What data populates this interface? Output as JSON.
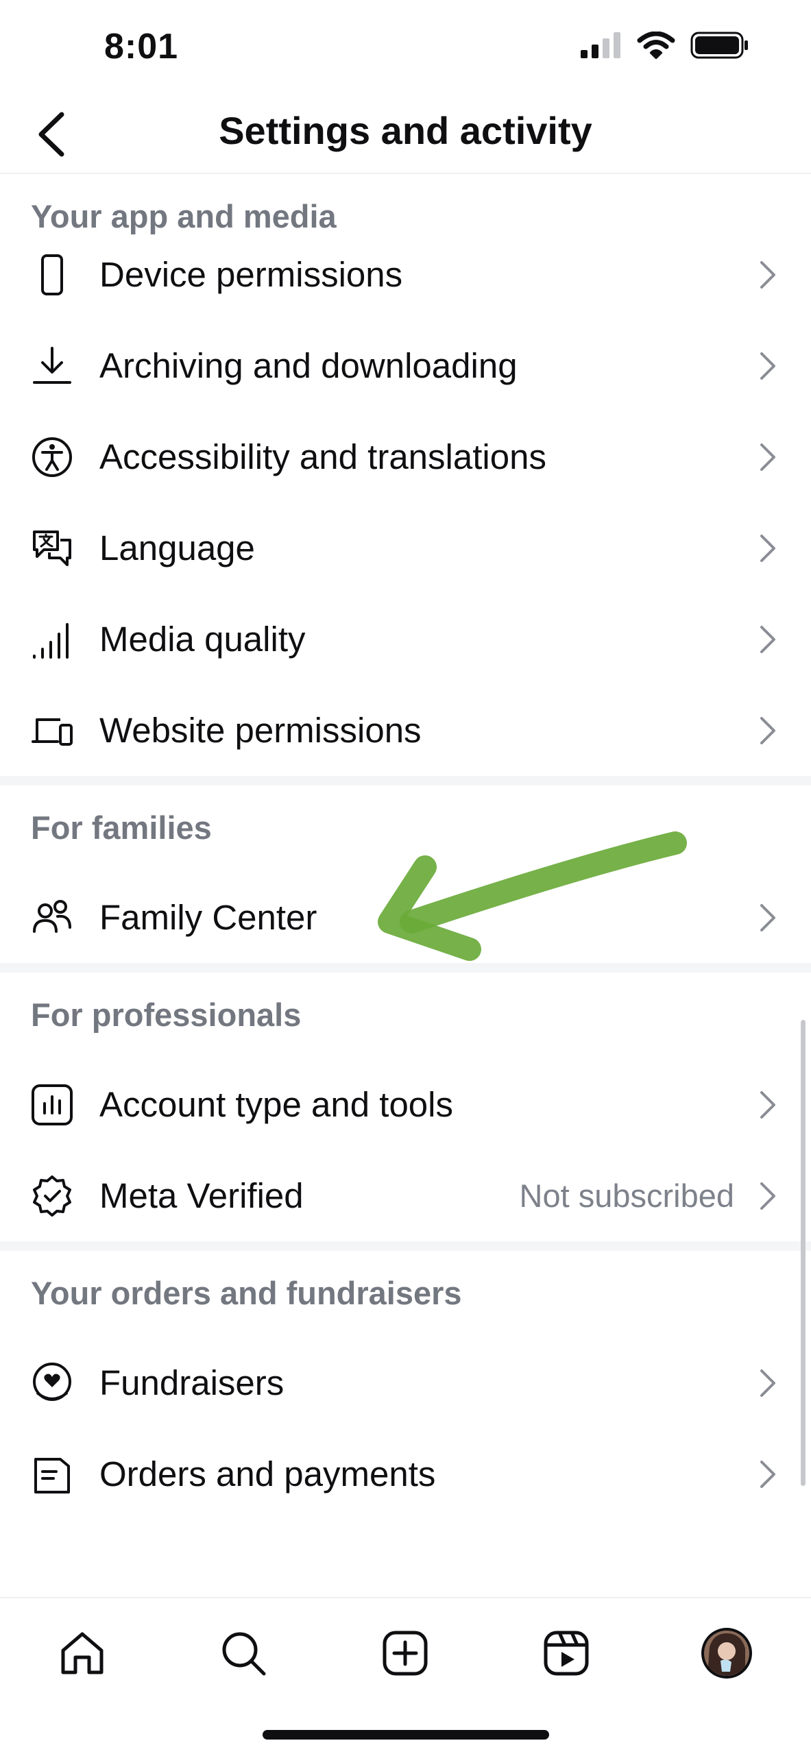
{
  "status_bar": {
    "time": "8:01"
  },
  "header": {
    "title": "Settings and activity"
  },
  "sections": [
    {
      "title": "Your app and media",
      "items": [
        {
          "label": "Device permissions",
          "icon": "phone-icon"
        },
        {
          "label": "Archiving and downloading",
          "icon": "download-icon"
        },
        {
          "label": "Accessibility and translations",
          "icon": "accessibility-icon"
        },
        {
          "label": "Language",
          "icon": "language-icon"
        },
        {
          "label": "Media quality",
          "icon": "signal-bars-icon"
        },
        {
          "label": "Website permissions",
          "icon": "laptop-phone-icon"
        }
      ]
    },
    {
      "title": "For families",
      "items": [
        {
          "label": "Family Center",
          "icon": "people-icon"
        }
      ]
    },
    {
      "title": "For professionals",
      "items": [
        {
          "label": "Account type and tools",
          "icon": "bar-chart-icon"
        },
        {
          "label": "Meta Verified",
          "icon": "verified-badge-icon",
          "value": "Not subscribed"
        }
      ]
    },
    {
      "title": "Your orders and fundraisers",
      "items": [
        {
          "label": "Fundraisers",
          "icon": "heart-coin-icon"
        },
        {
          "label": "Orders and payments",
          "icon": "receipt-icon"
        }
      ]
    }
  ],
  "tab_bar": [
    "home-icon",
    "search-icon",
    "create-icon",
    "reels-icon",
    "profile-avatar"
  ],
  "colors": {
    "text": "#0f0f12",
    "section_title": "#737780",
    "annotation_arrow": "#6aaa3a"
  }
}
